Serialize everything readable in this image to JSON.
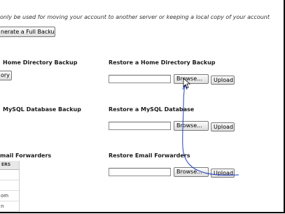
{
  "intro_text": "only be used for moving your account to another server or keeping a local copy of your account",
  "full_backup_button": "nerate a Full Backup",
  "sections": {
    "home": {
      "heading": "Home Directory Backup",
      "button": "ory",
      "restore_heading": "Restore a Home Directory Backup",
      "browse_label": "Browse...",
      "upload_label": "Upload"
    },
    "mysql": {
      "heading": "MySQL Database Backup",
      "restore_heading": "Restore a MySQL Database",
      "browse_label": "Browse...",
      "upload_label": "Upload"
    },
    "email": {
      "heading": "mail Forwarders",
      "restore_heading": "Restore Email Forwarders",
      "browse_label": "Browse...",
      "upload_label": "Upload",
      "table_header": "ERS",
      "table_rows": [
        "",
        "",
        "om",
        "n"
      ]
    }
  },
  "annotation_color": "#1f3fbf"
}
